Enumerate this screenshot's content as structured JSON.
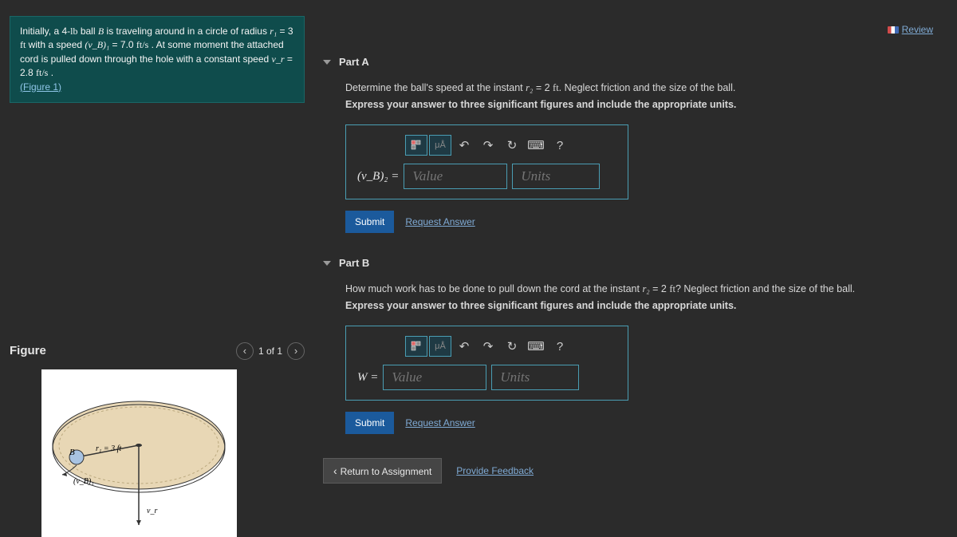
{
  "review": "Review",
  "problem": {
    "p1a": "Initially, a 4-",
    "p1b": " ball ",
    "p1c": " is traveling around in a circle of radius ",
    "p1d": " = 3 ",
    "p1e": " with a speed ",
    "p1f": " = 7.0 ",
    "p1g": " . At some moment the attached cord is pulled down through the hole with a constant speed ",
    "p1h": " = 2.8 ",
    "p1i": " .",
    "lb": "lb",
    "B": "B",
    "r1": "r₁",
    "ft": "ft",
    "vB1": "(v_B)₁",
    "fts": "ft/s",
    "vr": "v_r",
    "figlink": "(Figure 1)"
  },
  "figure": {
    "title": "Figure",
    "counter": "1 of 1",
    "labels": {
      "B": "B",
      "r1": "r₁ = 3 ft",
      "vB1": "(v_B)₁",
      "vr": "v_r"
    }
  },
  "partA": {
    "title": "Part A",
    "q1": "Determine the ball's speed at the instant ",
    "q2": " = 2 ",
    "q3": ". Neglect friction and the size of the ball.",
    "r2": "r₂",
    "ft": "ft",
    "instruction": "Express your answer to three significant figures and include the appropriate units.",
    "varlabel": "(v_B)₂ =",
    "value_ph": "Value",
    "units_ph": "Units",
    "submit": "Submit",
    "request": "Request Answer"
  },
  "partB": {
    "title": "Part B",
    "q1": "How much work has to be done to pull down the cord at the instant ",
    "q2": " = 2 ",
    "q3": "? Neglect friction and the size of the ball.",
    "r2": "r₂",
    "ft": "ft",
    "instruction": "Express your answer to three significant figures and include the appropriate units.",
    "varlabel": "W =",
    "value_ph": "Value",
    "units_ph": "Units",
    "submit": "Submit",
    "request": "Request Answer"
  },
  "footer": {
    "return": "Return to Assignment",
    "feedback": "Provide Feedback"
  },
  "toolbar": {
    "templates": "μÅ",
    "help": "?"
  }
}
